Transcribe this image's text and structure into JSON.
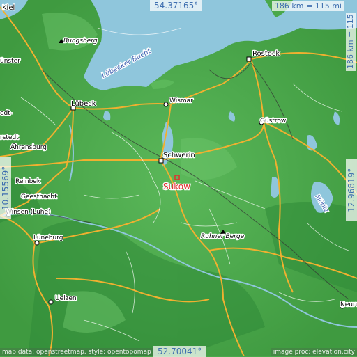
{
  "map": {
    "lat_top": "54.37165°",
    "lat_bottom": "52.70041°",
    "lon_left": "10.15569°",
    "lon_right": "12.96819°",
    "scale_h": "186 km = 115 mi",
    "scale_v": "186 km = 115 mi",
    "credit_left": "map data: openstreetmap, style: opentopomap",
    "credit_right": "image proc: elevation.city",
    "marker_label": "Sukow",
    "water_color": "#8fc6dc",
    "road_color": "#f0b030",
    "marker_color": "#e03030"
  },
  "places": [
    {
      "name": "Kiel"
    },
    {
      "name": "Bungsberg"
    },
    {
      "name": "Lübecker Bucht"
    },
    {
      "name": "Rostock"
    },
    {
      "name": "Lübeck"
    },
    {
      "name": "Wismar"
    },
    {
      "name": "Güstrow"
    },
    {
      "name": "Schwerin"
    },
    {
      "name": "Ahrensburg"
    },
    {
      "name": "Reinbek"
    },
    {
      "name": "Geesthacht"
    },
    {
      "name": "Winsen (Luhe)"
    },
    {
      "name": "Lüneburg"
    },
    {
      "name": "Ruhner Berge"
    },
    {
      "name": "Müritz"
    },
    {
      "name": "Uelzen"
    },
    {
      "name": "Neuru"
    },
    {
      "name": "ünster"
    },
    {
      "name": "edt-"
    },
    {
      "name": "rstedt"
    }
  ]
}
